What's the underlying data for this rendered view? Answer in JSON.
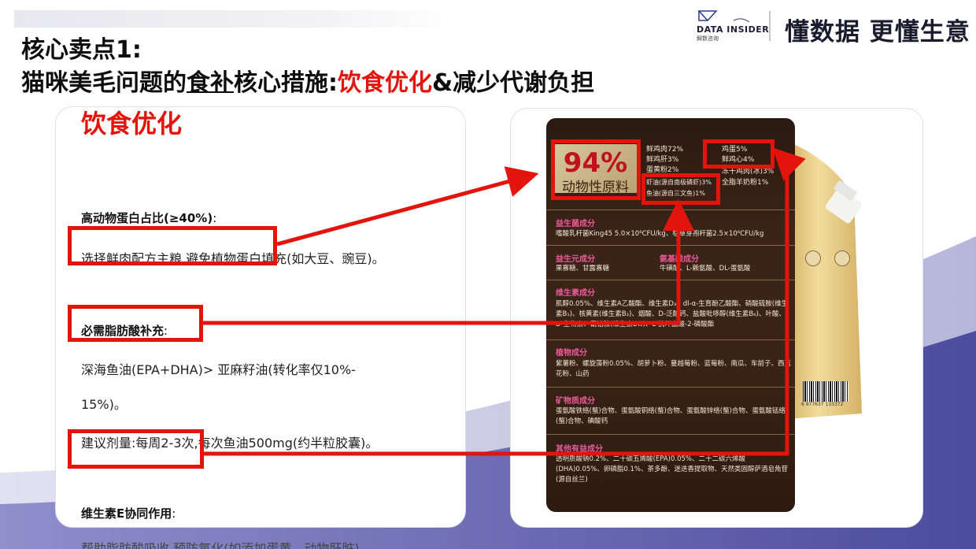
{
  "header": {
    "brand_name": "DATA INSIDER",
    "brand_sub": "解数咨询",
    "brand_tag": "Consulting",
    "slogan": "懂数据 更懂生意"
  },
  "title": {
    "line1": "核心卖点1:",
    "line2_prefix": "猫咪美毛问题的",
    "line2_underlined": "食补",
    "line2_mid": "核心措施:",
    "line2_highlight": "饮食优化",
    "line2_suffix": "&减少代谢负担"
  },
  "left_card": {
    "heading": "饮食优化",
    "section1_label": "高动物蛋白占比(≥40%)",
    "section1_colon": ":",
    "section1_text": "选择鲜肉配方主粮,避免植物蛋白填充(如大豆、豌豆)。",
    "section2_label": "必需脂肪酸补充",
    "section2_colon": ":",
    "section2_text_line1": "深海鱼油(EPA+DHA)> 亚麻籽油(转化率仅10%-",
    "section2_text_line2": "15%)。",
    "section2_text_line3": "建议剂量:每周2-3次,每次鱼油500mg(约半粒胶囊)。",
    "section3_label": "维生素E协同作用",
    "section3_colon": ":",
    "section3_text": "帮助脂肪酸吸收,预防氧化(如添加蛋黄、动物肝脏)。"
  },
  "product_label": {
    "badge_number": "94%",
    "badge_text": "动物性原料",
    "ingredients_left": [
      "鲜鸡肉72%",
      "鲜鸡肝3%",
      "蛋黄粉2%"
    ],
    "ingredients_right": [
      "鸡蛋5%",
      "鲜鸡心4%",
      "冻干鸡肉(冰)3%",
      "全脂羊奶粉1%"
    ],
    "shrimp_oil": "虾油(源自南极磷虾)3%",
    "fish_oil": "鱼油(源自三文鱼)1%",
    "sections": [
      {
        "title": "益生菌成分",
        "body": "嗜酸乳杆菌King45 5.0×10⁶CFU/kg、枯草芽孢杆菌2.5×10⁶CFU/kg"
      },
      {
        "title": "益生元成分",
        "body": "果寡糖、甘露寡糖"
      },
      {
        "title": "氨基酸成分",
        "body": "牛磺酸、L-赖氨酸、DL-蛋氨酸"
      },
      {
        "title": "维生素成分",
        "body": "肌醇0.05%、维生素A乙酸酯、维生素D₃、dl-α-生育酚乙酸酯、硝酸硫胺(维生素B₁)、核黄素(维生素B₂)、烟酸、D-泛酸钙、盐酸吡哆醇(维生素B₆)、叶酸、D-生物素、氰钴胺(维生素B₁₂)、L-抗坏血酸-2-磷酸酯"
      },
      {
        "title": "植物成分",
        "body": "紫薯粉、螺旋藻粉0.05%、胡萝卜粉、蔓越莓粉、蓝莓粉、南瓜、车前子、西蓝花粉、山药"
      },
      {
        "title": "矿物质成分",
        "body": "蛋氨酸铁络(螯)合物、蛋氨酸铜络(螯)合物、蛋氨酸锌络(螯)合物、蛋氨酸锰络(螯)合物、碘酸钙"
      },
      {
        "title": "其他有益成分",
        "body": "透明质酸钠0.2%、二十碳五烯酸(EPA)0.05%、二十二碳六烯酸(DHA)0.05%、卵磷脂0.1%、茶多酚、迷迭香提取物、天然类固醇萨酒皂角苷(源自丝兰)"
      }
    ],
    "barcode_number": "6 977637 133372"
  },
  "colors": {
    "accent_red": "#e3140c",
    "label_brown": "#3b2417",
    "wave_purple": "#5a5aa8"
  }
}
